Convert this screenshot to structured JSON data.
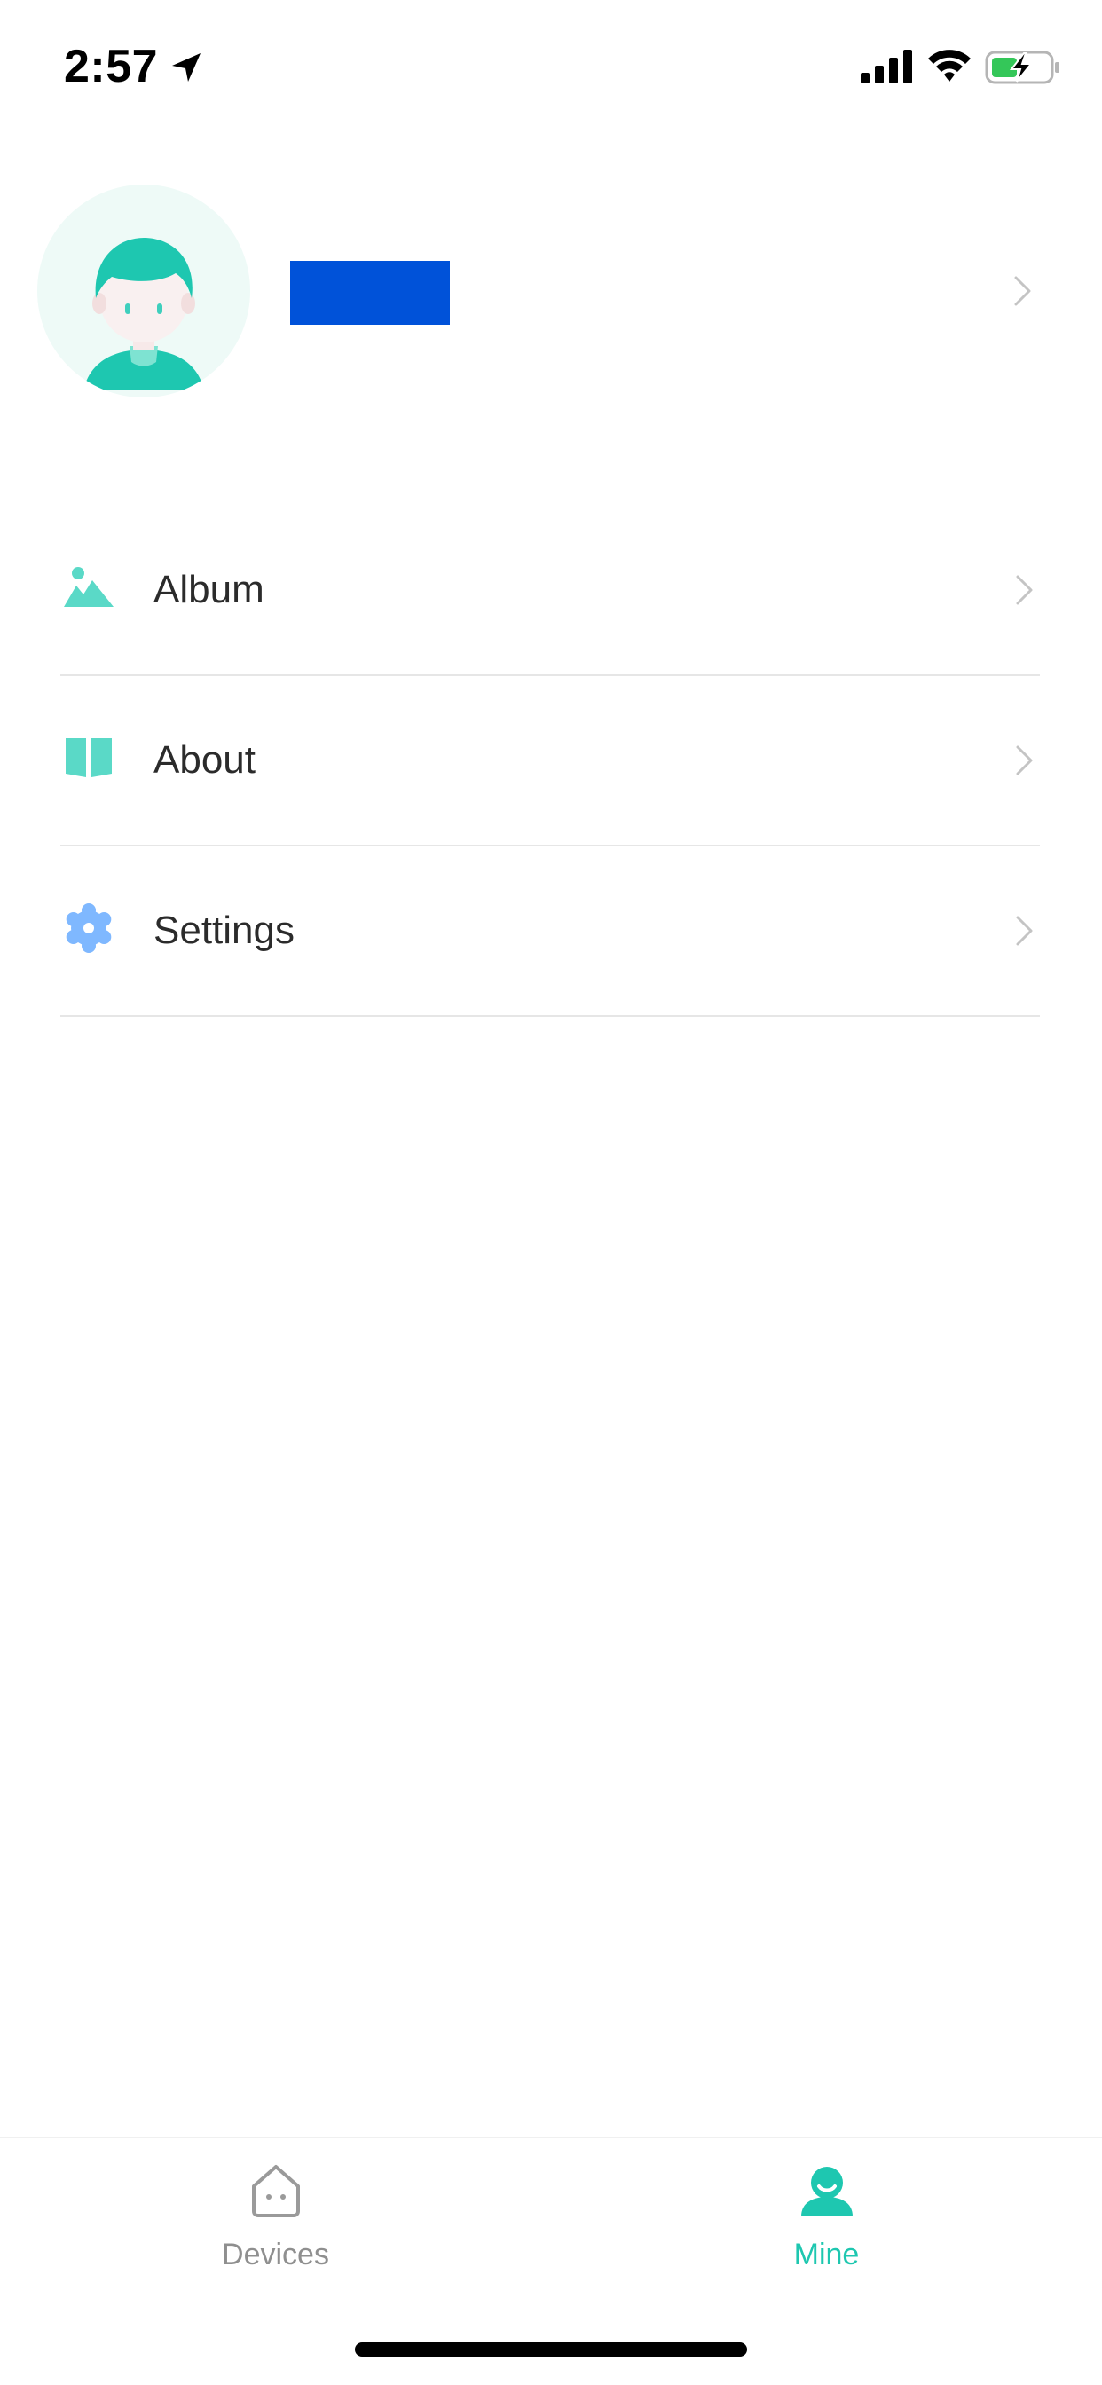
{
  "status_bar": {
    "time": "2:57",
    "icons": [
      "location-arrow-icon",
      "cellular-signal-icon",
      "wifi-icon",
      "battery-charging-icon"
    ]
  },
  "profile": {
    "avatar_icon": "user-avatar-icon",
    "username_redacted": true,
    "redaction_color": "#0052d9"
  },
  "menu": {
    "items": [
      {
        "label": "Album",
        "icon": "album-icon",
        "icon_color": "#5ad9c7"
      },
      {
        "label": "About",
        "icon": "book-icon",
        "icon_color": "#5ad9c7"
      },
      {
        "label": "Settings",
        "icon": "gear-icon",
        "icon_color": "#7fb8ff"
      }
    ]
  },
  "tabbar": {
    "tabs": [
      {
        "label": "Devices",
        "icon": "home-device-icon",
        "active": false
      },
      {
        "label": "Mine",
        "icon": "person-icon",
        "active": true
      }
    ],
    "active_color": "#1ec7b0",
    "inactive_color": "#8f8f8f"
  }
}
